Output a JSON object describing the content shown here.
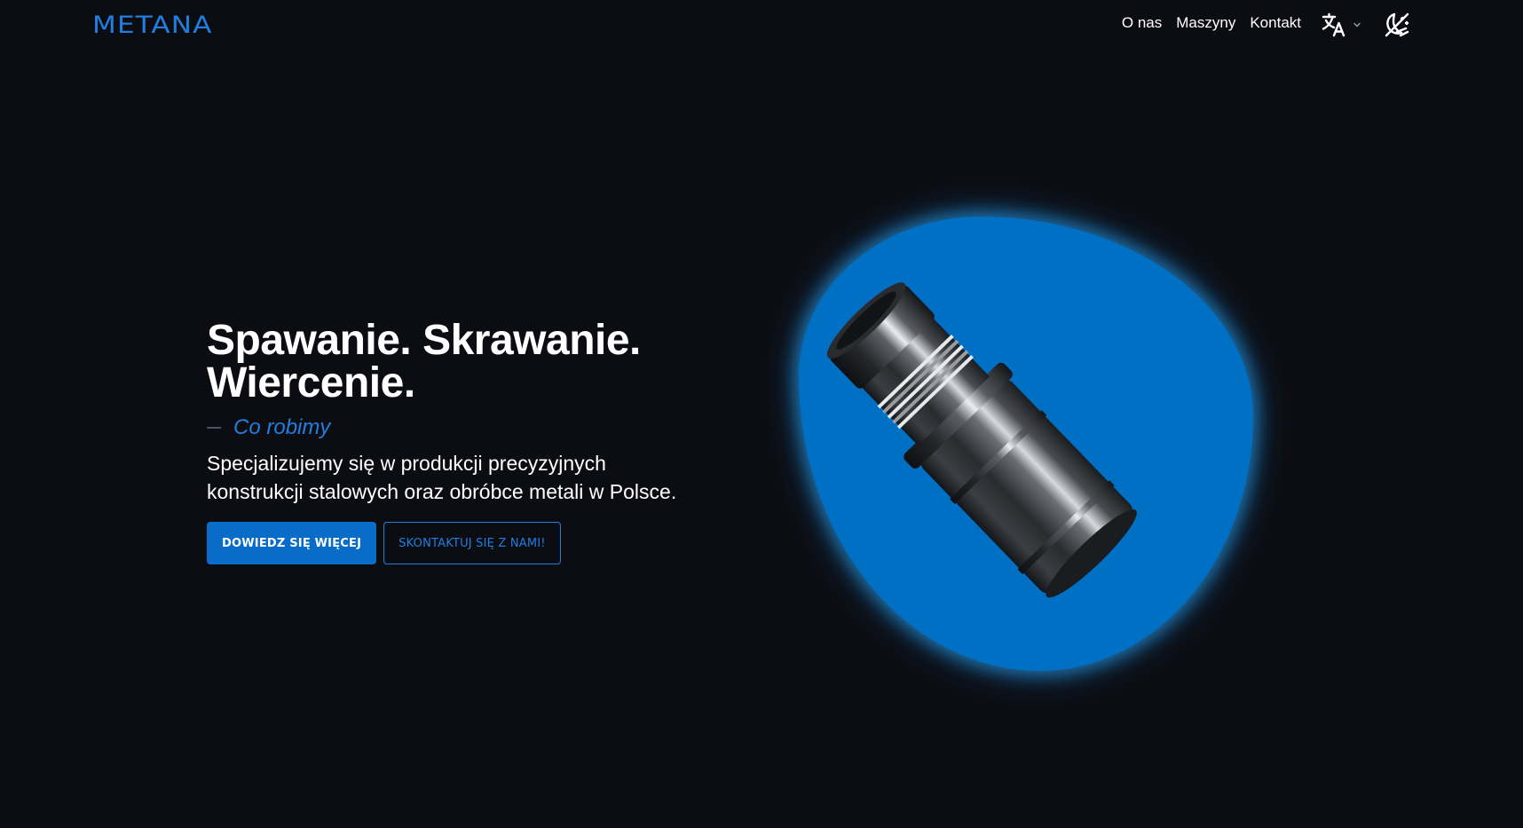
{
  "header": {
    "logo_text": "METANA",
    "nav": [
      {
        "label": "O nas"
      },
      {
        "label": "Maszyny"
      },
      {
        "label": "Kontakt"
      }
    ]
  },
  "hero": {
    "title_line1": "Spawanie. Skrawanie.",
    "title_line2": "Wiercenie.",
    "tagline": "Co robimy",
    "desc_line1": "Specjalizujemy się w produkcji precyzyjnych",
    "desc_line2": "konstrukcji stalowych oraz obróbce metali w Polsce.",
    "btn_primary": "DOWIEDZ SIĘ WIĘCEJ",
    "btn_secondary": "SKONTAKTUJ SIĘ Z NAMI!"
  },
  "colors": {
    "accent": "#1f7fe0",
    "blob": "#0070c4",
    "background": "#0c0d12"
  },
  "icons": {
    "language": "translate-icon",
    "chevron": "chevron-down-icon",
    "theme": "theme-toggle-icon"
  }
}
